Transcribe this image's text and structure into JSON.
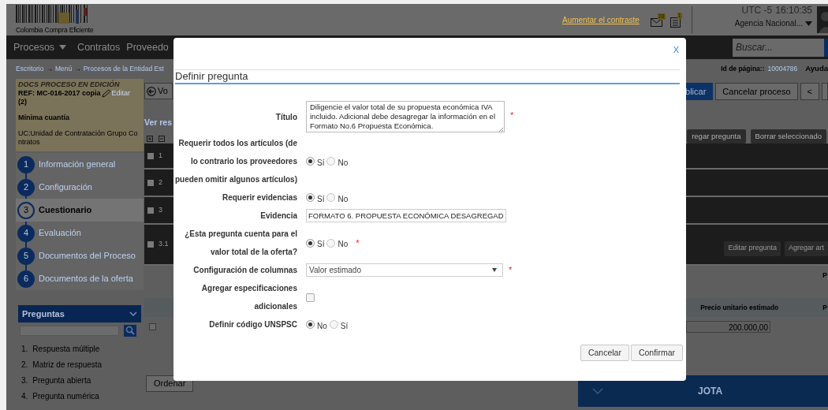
{
  "header": {
    "logo_text": "Colombia Compra Eficiente",
    "contrast_link": "Aumentar el contraste",
    "mail_badge": "28",
    "doc_badge": "1",
    "timezone": "UTC -5",
    "clock": "16:10:35",
    "agency": "Agencia Nacional..."
  },
  "nav": {
    "items": [
      {
        "label": "Procesos",
        "dropdown": true
      },
      {
        "label": "Contratos",
        "dropdown": false
      },
      {
        "label": "Proveedo",
        "dropdown": false
      }
    ],
    "search": {
      "placeholder": "Buscar..."
    }
  },
  "breadcrumb": {
    "items": [
      "Escritorio",
      "Menú",
      "Procesos de la Entidad Est"
    ],
    "separator": "→"
  },
  "page_info": {
    "label": "Id de página::",
    "id": "10004786",
    "help": "Ayuda"
  },
  "sidebar": {
    "status": "DOCS PROCESO EN EDICIÓN",
    "ref": "REF: MC-016-2017 copia",
    "edit": "Editar",
    "count": "(2)",
    "modality": "Mínima cuantía",
    "unit": "UC:Unidad de Contratación Grupo Contratos",
    "steps": [
      {
        "number": "1",
        "label": "Información general",
        "selected": false
      },
      {
        "number": "2",
        "label": "Configuración",
        "selected": false
      },
      {
        "number": "3",
        "label": "Cuestionario",
        "selected": true
      },
      {
        "number": "4",
        "label": "Evaluación",
        "selected": false
      },
      {
        "number": "5",
        "label": "Documentos del Proceso",
        "selected": false
      },
      {
        "number": "6",
        "label": "Documentos de la oferta",
        "selected": false
      }
    ],
    "questions": {
      "title": "Preguntas",
      "items": [
        {
          "number": "1.",
          "label": "Respuesta múltiple"
        },
        {
          "number": "2.",
          "label": "Matriz de respuesta"
        },
        {
          "number": "3.",
          "label": "Pregunta abierta"
        },
        {
          "number": "4.",
          "label": "Pregunta numérica"
        }
      ]
    }
  },
  "main": {
    "back_button": "Vo",
    "results_link": "Ver res",
    "toolbar": [
      {
        "label": "blicar",
        "kind": "primary"
      },
      {
        "label": "Cancelar proceso",
        "kind": "default"
      },
      {
        "label": "<",
        "kind": "default"
      }
    ],
    "question_buttons": [
      "regar pregunta",
      "Borrar seleccionado"
    ],
    "rows": [
      {
        "number": "1",
        "checked": false
      },
      {
        "number": "2",
        "checked": false
      },
      {
        "number": "3",
        "checked": false
      },
      {
        "number": "3.1",
        "checked": false,
        "actions": [
          "Editar pregunta",
          "Agregar art"
        ]
      }
    ],
    "item_checked": false,
    "column_3": "P",
    "columns": [
      "Precio unitario estimado",
      "P"
    ],
    "price": "200.000,00",
    "sort_button": "Ordenar",
    "group_title": "JOTA"
  },
  "modal": {
    "close": "X",
    "title": "Definir pregunta",
    "required_mark": "*",
    "fields": [
      {
        "kind": "textarea",
        "label": "Título",
        "value": "Diligencie el valor total de su propuesta económica IVA incluido. Adicional debe desagregar la información en el Formato No.6 Propuesta Económica.",
        "required": true
      },
      {
        "kind": "radio",
        "label": "Requerir todos los artículos (de lo contrario los proveedores pueden omitir algunos artículos)",
        "required": false,
        "options": [
          {
            "label": "Sí",
            "selected": true
          },
          {
            "label": "No",
            "selected": false
          }
        ]
      },
      {
        "kind": "radio",
        "label": "Requerir evidencias",
        "required": false,
        "options": [
          {
            "label": "Sí",
            "selected": true
          },
          {
            "label": "No",
            "selected": false
          }
        ]
      },
      {
        "kind": "text",
        "label": "Evidencia",
        "value": "FORMATO 6. PROPUESTA ECONÓMICA DESAGREGAD",
        "required": false
      },
      {
        "kind": "radio",
        "label": "¿Esta pregunta cuenta para el valor total de la oferta?",
        "required": true,
        "options": [
          {
            "label": "Sí",
            "selected": true
          },
          {
            "label": "No",
            "selected": false
          }
        ]
      },
      {
        "kind": "select",
        "label": "Configuración de columnas",
        "value": "Valor estimado",
        "required": true
      },
      {
        "kind": "checkbox",
        "label": "Agregar especificaciones adicionales",
        "checked": false,
        "required": false
      },
      {
        "kind": "radio",
        "label": "Definir código UNSPSC",
        "required": false,
        "options": [
          {
            "label": "No",
            "selected": true
          },
          {
            "label": "Sí",
            "selected": false
          }
        ]
      }
    ],
    "buttons": [
      "Cancelar",
      "Confirmar"
    ]
  }
}
